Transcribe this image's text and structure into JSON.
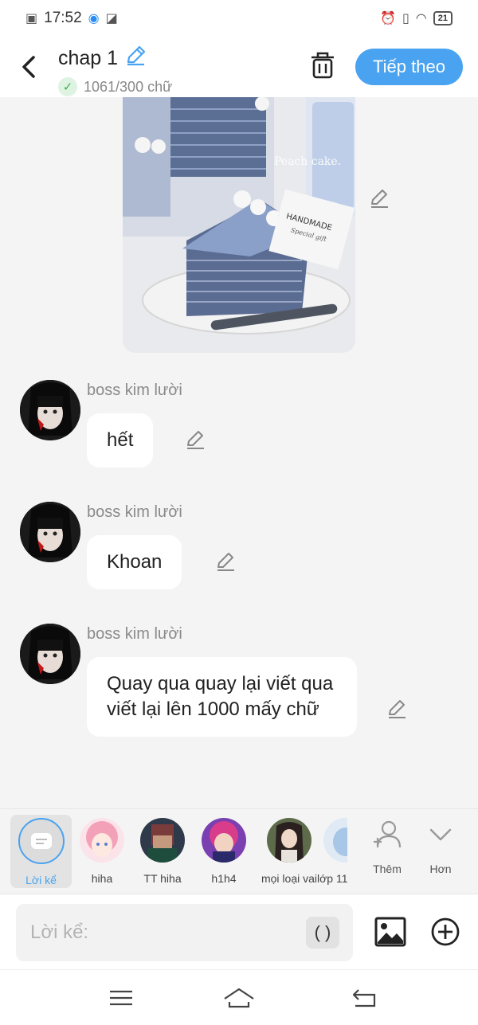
{
  "status_bar": {
    "time": "17:52",
    "battery": "21"
  },
  "header": {
    "title": "chap 1",
    "word_count": "1061/300 chữ",
    "next_label": "Tiếp theo"
  },
  "messages": [
    {
      "sender": "boss kim lười",
      "text": "hết"
    },
    {
      "sender": "boss kim lười",
      "text": "Khoan"
    },
    {
      "sender": "boss kim lười",
      "text": "Quay qua quay lại viết qua viết lại lên 1000 mấy chữ"
    }
  ],
  "image_text": {
    "watermark": "Peach cake.",
    "card_line1": "HANDMADE",
    "card_line2": "Special gift"
  },
  "characters": [
    {
      "name": "Lời kể",
      "selected": true
    },
    {
      "name": "hiha"
    },
    {
      "name": "TT hiha"
    },
    {
      "name": "h1h4"
    },
    {
      "name": "mọi loại vai"
    },
    {
      "name": "lớp 11"
    }
  ],
  "tools": {
    "add_label": "Thêm",
    "more_label": "Hơn"
  },
  "input": {
    "placeholder": "Lời kể:",
    "paren_label": "( )"
  },
  "colors": {
    "accent": "#4aa3f0",
    "background": "#f4f4f4",
    "check_green": "#39b54a"
  }
}
